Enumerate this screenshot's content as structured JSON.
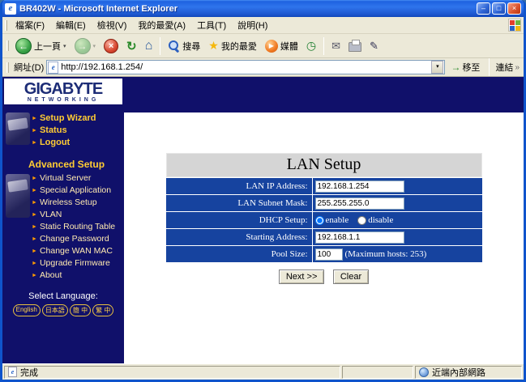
{
  "window": {
    "title": "BR402W - Microsoft Internet Explorer",
    "menu": [
      "檔案(F)",
      "編輯(E)",
      "檢視(V)",
      "我的最愛(A)",
      "工具(T)",
      "說明(H)"
    ],
    "toolbar": {
      "back": "上一頁",
      "search": "搜尋",
      "favorites": "我的最愛",
      "media": "媒體"
    },
    "address": {
      "label": "網址(D)",
      "url": "http://192.168.1.254/",
      "go": "移至",
      "links": "連結"
    },
    "status": {
      "done": "完成",
      "zone": "近端內部網路"
    },
    "icons": {
      "ie_glyph": "e",
      "back": "←",
      "forward": "→",
      "stop": "×",
      "refresh": "↻",
      "home": "⌂",
      "star": "★",
      "media_play": "▶",
      "history": "◷",
      "mail": "✉",
      "edit": "✎",
      "dropdown": "▾",
      "go_arrow": "→",
      "links_chevron": "»",
      "min": "–",
      "max": "□",
      "close": "×"
    }
  },
  "sidebar": {
    "logo_line1": "GIGABYTE",
    "logo_line2": "NETWORKING",
    "items": [
      "Setup Wizard",
      "Status",
      "Logout"
    ],
    "advanced_title": "Advanced Setup",
    "advanced_items": [
      "Virtual Server",
      "Special Application",
      "Wireless Setup",
      "VLAN",
      "Static Routing Table",
      "Change Password",
      "Change WAN MAC",
      "Upgrade Firmware",
      "About"
    ],
    "language_label": "Select Language:",
    "languages": [
      "English",
      "日本語",
      "簡 中",
      "繁 中"
    ]
  },
  "page": {
    "title": "LAN Setup",
    "rows": [
      {
        "label": "LAN IP Address:",
        "value": "192.168.1.254"
      },
      {
        "label": "LAN Subnet Mask:",
        "value": "255.255.255.0"
      },
      {
        "label": "DHCP Setup:",
        "options": [
          "enable",
          "disable"
        ],
        "selected": "enable"
      },
      {
        "label": "Starting Address:",
        "value": "192.168.1.1"
      },
      {
        "label": "Pool Size:",
        "value": "100",
        "suffix": "(Maximum hosts: 253)"
      }
    ],
    "buttons": {
      "next": "Next >>",
      "clear": "Clear"
    }
  },
  "colors": {
    "sidebar_navy": "#10106a",
    "row_blue": "#16439f",
    "menu_gold": "#ffcc33"
  }
}
